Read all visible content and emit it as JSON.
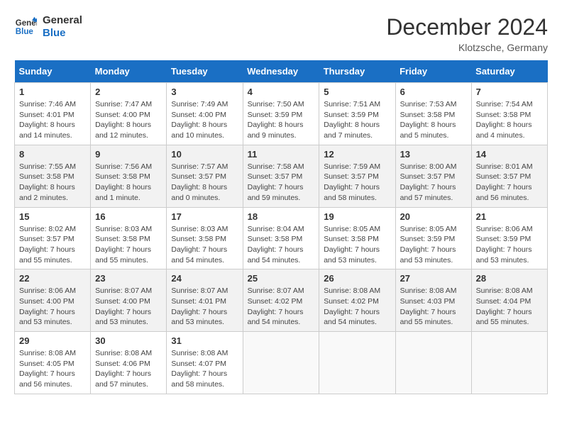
{
  "header": {
    "logo_line1": "General",
    "logo_line2": "Blue",
    "month": "December 2024",
    "location": "Klotzsche, Germany"
  },
  "weekdays": [
    "Sunday",
    "Monday",
    "Tuesday",
    "Wednesday",
    "Thursday",
    "Friday",
    "Saturday"
  ],
  "weeks": [
    [
      {
        "day": 1,
        "info": "Sunrise: 7:46 AM\nSunset: 4:01 PM\nDaylight: 8 hours\nand 14 minutes."
      },
      {
        "day": 2,
        "info": "Sunrise: 7:47 AM\nSunset: 4:00 PM\nDaylight: 8 hours\nand 12 minutes."
      },
      {
        "day": 3,
        "info": "Sunrise: 7:49 AM\nSunset: 4:00 PM\nDaylight: 8 hours\nand 10 minutes."
      },
      {
        "day": 4,
        "info": "Sunrise: 7:50 AM\nSunset: 3:59 PM\nDaylight: 8 hours\nand 9 minutes."
      },
      {
        "day": 5,
        "info": "Sunrise: 7:51 AM\nSunset: 3:59 PM\nDaylight: 8 hours\nand 7 minutes."
      },
      {
        "day": 6,
        "info": "Sunrise: 7:53 AM\nSunset: 3:58 PM\nDaylight: 8 hours\nand 5 minutes."
      },
      {
        "day": 7,
        "info": "Sunrise: 7:54 AM\nSunset: 3:58 PM\nDaylight: 8 hours\nand 4 minutes."
      }
    ],
    [
      {
        "day": 8,
        "info": "Sunrise: 7:55 AM\nSunset: 3:58 PM\nDaylight: 8 hours\nand 2 minutes."
      },
      {
        "day": 9,
        "info": "Sunrise: 7:56 AM\nSunset: 3:58 PM\nDaylight: 8 hours\nand 1 minute."
      },
      {
        "day": 10,
        "info": "Sunrise: 7:57 AM\nSunset: 3:57 PM\nDaylight: 8 hours\nand 0 minutes."
      },
      {
        "day": 11,
        "info": "Sunrise: 7:58 AM\nSunset: 3:57 PM\nDaylight: 7 hours\nand 59 minutes."
      },
      {
        "day": 12,
        "info": "Sunrise: 7:59 AM\nSunset: 3:57 PM\nDaylight: 7 hours\nand 58 minutes."
      },
      {
        "day": 13,
        "info": "Sunrise: 8:00 AM\nSunset: 3:57 PM\nDaylight: 7 hours\nand 57 minutes."
      },
      {
        "day": 14,
        "info": "Sunrise: 8:01 AM\nSunset: 3:57 PM\nDaylight: 7 hours\nand 56 minutes."
      }
    ],
    [
      {
        "day": 15,
        "info": "Sunrise: 8:02 AM\nSunset: 3:57 PM\nDaylight: 7 hours\nand 55 minutes."
      },
      {
        "day": 16,
        "info": "Sunrise: 8:03 AM\nSunset: 3:58 PM\nDaylight: 7 hours\nand 55 minutes."
      },
      {
        "day": 17,
        "info": "Sunrise: 8:03 AM\nSunset: 3:58 PM\nDaylight: 7 hours\nand 54 minutes."
      },
      {
        "day": 18,
        "info": "Sunrise: 8:04 AM\nSunset: 3:58 PM\nDaylight: 7 hours\nand 54 minutes."
      },
      {
        "day": 19,
        "info": "Sunrise: 8:05 AM\nSunset: 3:58 PM\nDaylight: 7 hours\nand 53 minutes."
      },
      {
        "day": 20,
        "info": "Sunrise: 8:05 AM\nSunset: 3:59 PM\nDaylight: 7 hours\nand 53 minutes."
      },
      {
        "day": 21,
        "info": "Sunrise: 8:06 AM\nSunset: 3:59 PM\nDaylight: 7 hours\nand 53 minutes."
      }
    ],
    [
      {
        "day": 22,
        "info": "Sunrise: 8:06 AM\nSunset: 4:00 PM\nDaylight: 7 hours\nand 53 minutes."
      },
      {
        "day": 23,
        "info": "Sunrise: 8:07 AM\nSunset: 4:00 PM\nDaylight: 7 hours\nand 53 minutes."
      },
      {
        "day": 24,
        "info": "Sunrise: 8:07 AM\nSunset: 4:01 PM\nDaylight: 7 hours\nand 53 minutes."
      },
      {
        "day": 25,
        "info": "Sunrise: 8:07 AM\nSunset: 4:02 PM\nDaylight: 7 hours\nand 54 minutes."
      },
      {
        "day": 26,
        "info": "Sunrise: 8:08 AM\nSunset: 4:02 PM\nDaylight: 7 hours\nand 54 minutes."
      },
      {
        "day": 27,
        "info": "Sunrise: 8:08 AM\nSunset: 4:03 PM\nDaylight: 7 hours\nand 55 minutes."
      },
      {
        "day": 28,
        "info": "Sunrise: 8:08 AM\nSunset: 4:04 PM\nDaylight: 7 hours\nand 55 minutes."
      }
    ],
    [
      {
        "day": 29,
        "info": "Sunrise: 8:08 AM\nSunset: 4:05 PM\nDaylight: 7 hours\nand 56 minutes."
      },
      {
        "day": 30,
        "info": "Sunrise: 8:08 AM\nSunset: 4:06 PM\nDaylight: 7 hours\nand 57 minutes."
      },
      {
        "day": 31,
        "info": "Sunrise: 8:08 AM\nSunset: 4:07 PM\nDaylight: 7 hours\nand 58 minutes."
      },
      null,
      null,
      null,
      null
    ]
  ]
}
